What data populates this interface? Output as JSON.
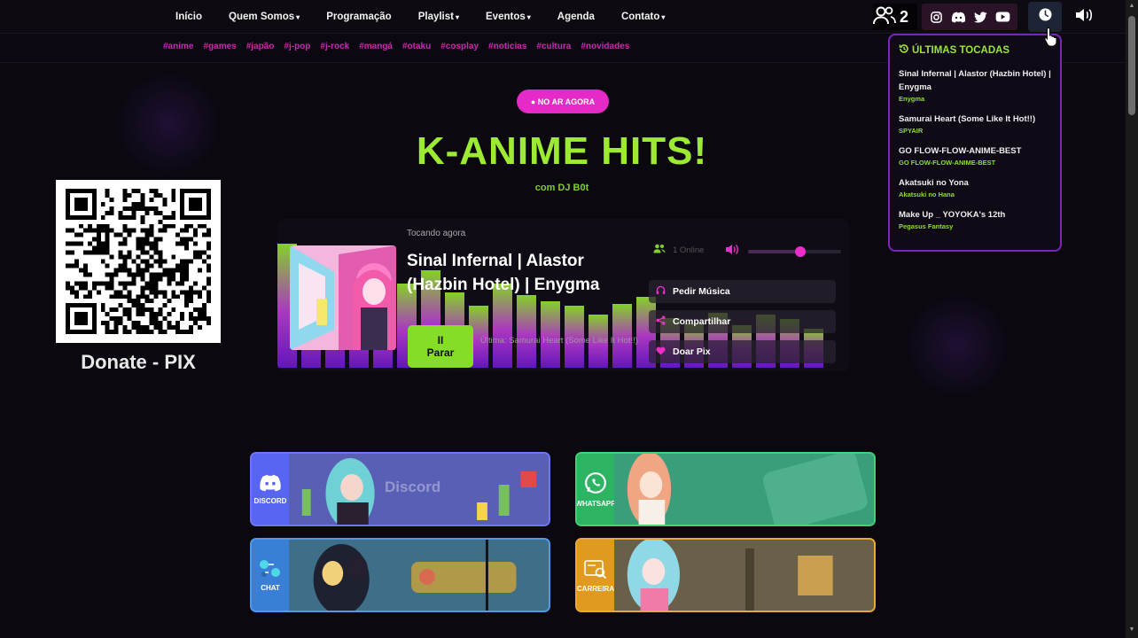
{
  "nav": {
    "links": [
      {
        "label": "Início",
        "dropdown": false
      },
      {
        "label": "Quem Somos",
        "dropdown": true
      },
      {
        "label": "Programação",
        "dropdown": false
      },
      {
        "label": "Playlist",
        "dropdown": true
      },
      {
        "label": "Eventos",
        "dropdown": true
      },
      {
        "label": "Agenda",
        "dropdown": false
      },
      {
        "label": "Contato",
        "dropdown": true
      }
    ],
    "users_count": "2",
    "social_icons": [
      "instagram-icon",
      "discord-icon",
      "twitter-icon",
      "youtube-icon"
    ]
  },
  "tags": [
    "#anime",
    "#games",
    "#japão",
    "#j-pop",
    "#j-rock",
    "#mangá",
    "#otaku",
    "#cosplay",
    "#noticias",
    "#cultura",
    "#novidades"
  ],
  "hero": {
    "badge": "● NO AR AGORA",
    "title": "K-ANIME HITS!",
    "subtitle": "com DJ B0t"
  },
  "donate": {
    "label": "Donate - PIX"
  },
  "player": {
    "now_playing_label": "Tocando agora",
    "track_title": "Sinal Infernal | Alastor (Hazbin Hotel) | Enygma",
    "stop_icon": "II",
    "stop_label": "Parar",
    "last_played": "Última: Samurai Heart (Some Like It Hot!!)",
    "online_text": "1 Online",
    "volume_level": 0.56,
    "actions": [
      "Pedir Música",
      "Compartilhar",
      "Doar Pix"
    ],
    "colors": {
      "accent_green": "#85dd27",
      "accent_pink": "#ea2fc8"
    }
  },
  "recent": {
    "title": "ÚLTIMAS TOCADAS",
    "items": [
      {
        "song": "Sinal Infernal | Alastor (Hazbin Hotel) | Enygma",
        "artist": "Enygma"
      },
      {
        "song": "Samurai Heart (Some Like It Hot!!)",
        "artist": "SPYAIR"
      },
      {
        "song": "GO FLOW-FLOW-ANIME-BEST",
        "artist": "GO FLOW-FLOW-ANIME-BEST"
      },
      {
        "song": "Akatsuki no Yona",
        "artist": "Akatsuki no Hana"
      },
      {
        "song": "Make Up _ YOYOKA's 12th",
        "artist": "Pegasus Fantasy"
      }
    ]
  },
  "cards": [
    {
      "id": "discord",
      "side_label": "DISCORD",
      "art_text": "Discord",
      "color": "#5865f2"
    },
    {
      "id": "whatsapp",
      "side_label": "WHATSAPP",
      "art_text": "",
      "color": "#25a55a"
    },
    {
      "id": "chat",
      "side_label": "CHAT",
      "art_text": "",
      "color": "#3a7fd6"
    },
    {
      "id": "carreira",
      "side_label": "CARREIRA",
      "art_text": "",
      "color": "#e09a1f"
    }
  ]
}
